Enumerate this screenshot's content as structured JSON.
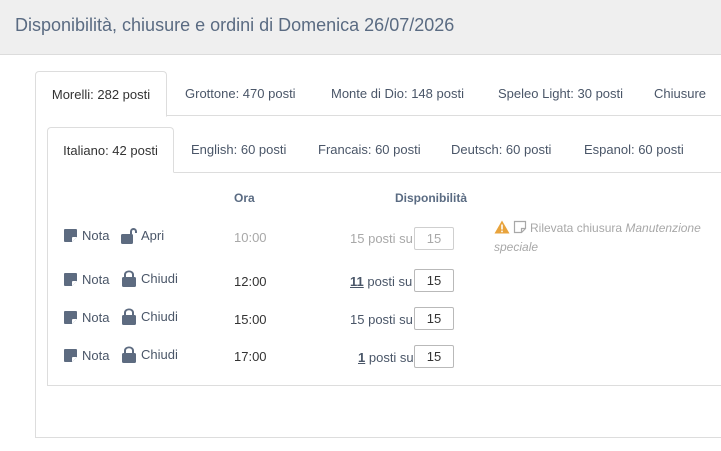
{
  "header": {
    "title": "Disponibilità, chiusure e ordini di Domenica 26/07/2026"
  },
  "location_tabs": [
    {
      "label": "Morelli: 282 posti",
      "active": true
    },
    {
      "label": "Grottone: 470 posti",
      "active": false
    },
    {
      "label": "Monte di Dio: 148 posti",
      "active": false
    },
    {
      "label": "Speleo Light: 30 posti",
      "active": false
    },
    {
      "label": "Chiusure",
      "active": false
    }
  ],
  "language_tabs": [
    {
      "label": "Italiano: 42 posti",
      "active": true
    },
    {
      "label": "English: 60 posti",
      "active": false
    },
    {
      "label": "Francais: 60 posti",
      "active": false
    },
    {
      "label": "Deutsch: 60 posti",
      "active": false
    },
    {
      "label": "Espanol: 60 posti",
      "active": false
    }
  ],
  "table": {
    "col_time": "Ora",
    "col_availability": "Disponibilità",
    "rows": [
      {
        "note_label": "Nota",
        "lock_label": "Apri",
        "lock_state": "open",
        "time": "10:00",
        "available": "15",
        "available_link": false,
        "suffix": "posti su",
        "capacity": "15",
        "muted": true
      },
      {
        "note_label": "Nota",
        "lock_label": "Chiudi",
        "lock_state": "closed",
        "time": "12:00",
        "available": "11",
        "available_link": true,
        "suffix": "posti su",
        "capacity": "15",
        "muted": false
      },
      {
        "note_label": "Nota",
        "lock_label": "Chiudi",
        "lock_state": "closed",
        "time": "15:00",
        "available": "15",
        "available_link": false,
        "suffix": "posti su",
        "capacity": "15",
        "muted": false
      },
      {
        "note_label": "Nota",
        "lock_label": "Chiudi",
        "lock_state": "closed",
        "time": "17:00",
        "available": "1",
        "available_link": true,
        "suffix": "posti su",
        "capacity": "15",
        "muted": false
      }
    ]
  },
  "closure_note": {
    "prefix": "Rilevata chiusura",
    "reason": "Manutenzione speciale"
  },
  "colors": {
    "accent": "#5a6b82",
    "warning": "#e8a33c",
    "muted": "#a8a8a8",
    "icon": "#5d6b80"
  }
}
